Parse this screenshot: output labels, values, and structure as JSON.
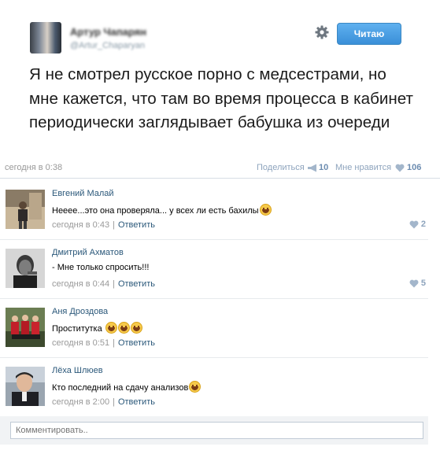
{
  "tweet": {
    "author_name": "Артур Чапарян",
    "author_handle": "@Artur_Chaparyan",
    "follow_label": "Читаю",
    "text": "Я не смотрел русское порно с медсестрами, но мне кажется, что там во время процесса в кабинет периодически заглядывает бабушка из очереди"
  },
  "post_meta": {
    "time": "сегодня в 0:38",
    "share_label": "Поделиться",
    "share_count": "10",
    "like_label": "Мне нравится",
    "like_count": "106"
  },
  "comments": [
    {
      "author": "Евгений Малай",
      "text": "Неееe...это она проверяла... у всех ли есть бахилы",
      "emoji_count": 1,
      "time": "сегодня в 0:43",
      "reply": "Ответить",
      "likes": "2"
    },
    {
      "author": "Дмитрий Ахматов",
      "text": "- Мне только спросить!!!",
      "emoji_count": 0,
      "time": "сегодня в 0:44",
      "reply": "Ответить",
      "likes": "5"
    },
    {
      "author": "Аня Дроздова",
      "text": "Проститутка",
      "emoji_count": 3,
      "time": "сегодня в 0:51",
      "reply": "Ответить",
      "likes": ""
    },
    {
      "author": "Лёха Шлюев",
      "text": "Кто последний на сдачу анализов",
      "emoji_count": 1,
      "time": "сегодня в 2:00",
      "reply": "Ответить",
      "likes": ""
    }
  ],
  "comment_box": {
    "placeholder": "Комментировать.."
  },
  "colors": {
    "link": "#2b587a",
    "follow_button": "#3a8fd8",
    "muted": "#999999",
    "like_icon": "#a3b6cb"
  },
  "icons": {
    "settings": "gear-icon",
    "share": "megaphone-icon",
    "like": "heart-icon",
    "emoji": "grinning-face-emoji"
  }
}
